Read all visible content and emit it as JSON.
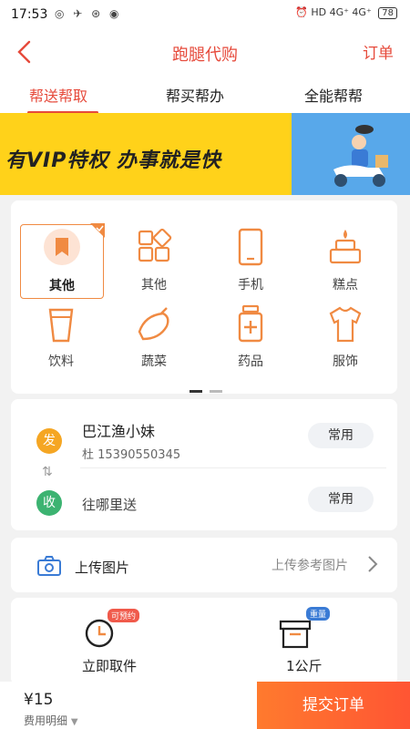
{
  "status": {
    "time": "17:53",
    "left_icons": "◎ ✈ ⊛ ◉",
    "right_icons": "⏰ HD 4G⁺ 4G⁺",
    "battery": "78"
  },
  "header": {
    "back_icon": "chevron-left-icon",
    "title": "跑腿代购",
    "order": "订单"
  },
  "tabs": [
    "帮送帮取",
    "帮买帮办",
    "全能帮帮"
  ],
  "banner": {
    "text": "有VIP特权  办事就是快",
    "colors": {
      "left": "#ffd21a",
      "right": "#58a8ea"
    }
  },
  "categories": [
    {
      "label": "其他",
      "icon": "flag-icon",
      "selected": true
    },
    {
      "label": "其他",
      "icon": "grid-icon",
      "selected": false
    },
    {
      "label": "手机",
      "icon": "phone-icon",
      "selected": false
    },
    {
      "label": "糕点",
      "icon": "cake-icon",
      "selected": false
    },
    {
      "label": "饮料",
      "icon": "drink-icon",
      "selected": false
    },
    {
      "label": "蔬菜",
      "icon": "eggplant-icon",
      "selected": false
    },
    {
      "label": "药品",
      "icon": "medicine-icon",
      "selected": false
    },
    {
      "label": "服饰",
      "icon": "shirt-icon",
      "selected": false
    }
  ],
  "pickup": {
    "badge": "发",
    "name": "巴江渔小妹",
    "phone": "杜 15390550345",
    "frequent": "常用"
  },
  "dropoff": {
    "badge": "收",
    "placeholder": "往哪里送",
    "frequent": "常用"
  },
  "upload": {
    "label": "上传图片",
    "hint": "上传参考图片"
  },
  "options": {
    "time": {
      "label": "立即取件",
      "tag": "可预约"
    },
    "weight": {
      "label": "1公斤",
      "tag": "重量"
    }
  },
  "footer": {
    "price": "¥15",
    "detail": "费用明细",
    "submit": "提交订单"
  },
  "colors": {
    "accent": "#e64a3b",
    "orange": "#f08a42",
    "pickup_badge": "#f5a623",
    "dropoff_badge": "#3cb371"
  }
}
